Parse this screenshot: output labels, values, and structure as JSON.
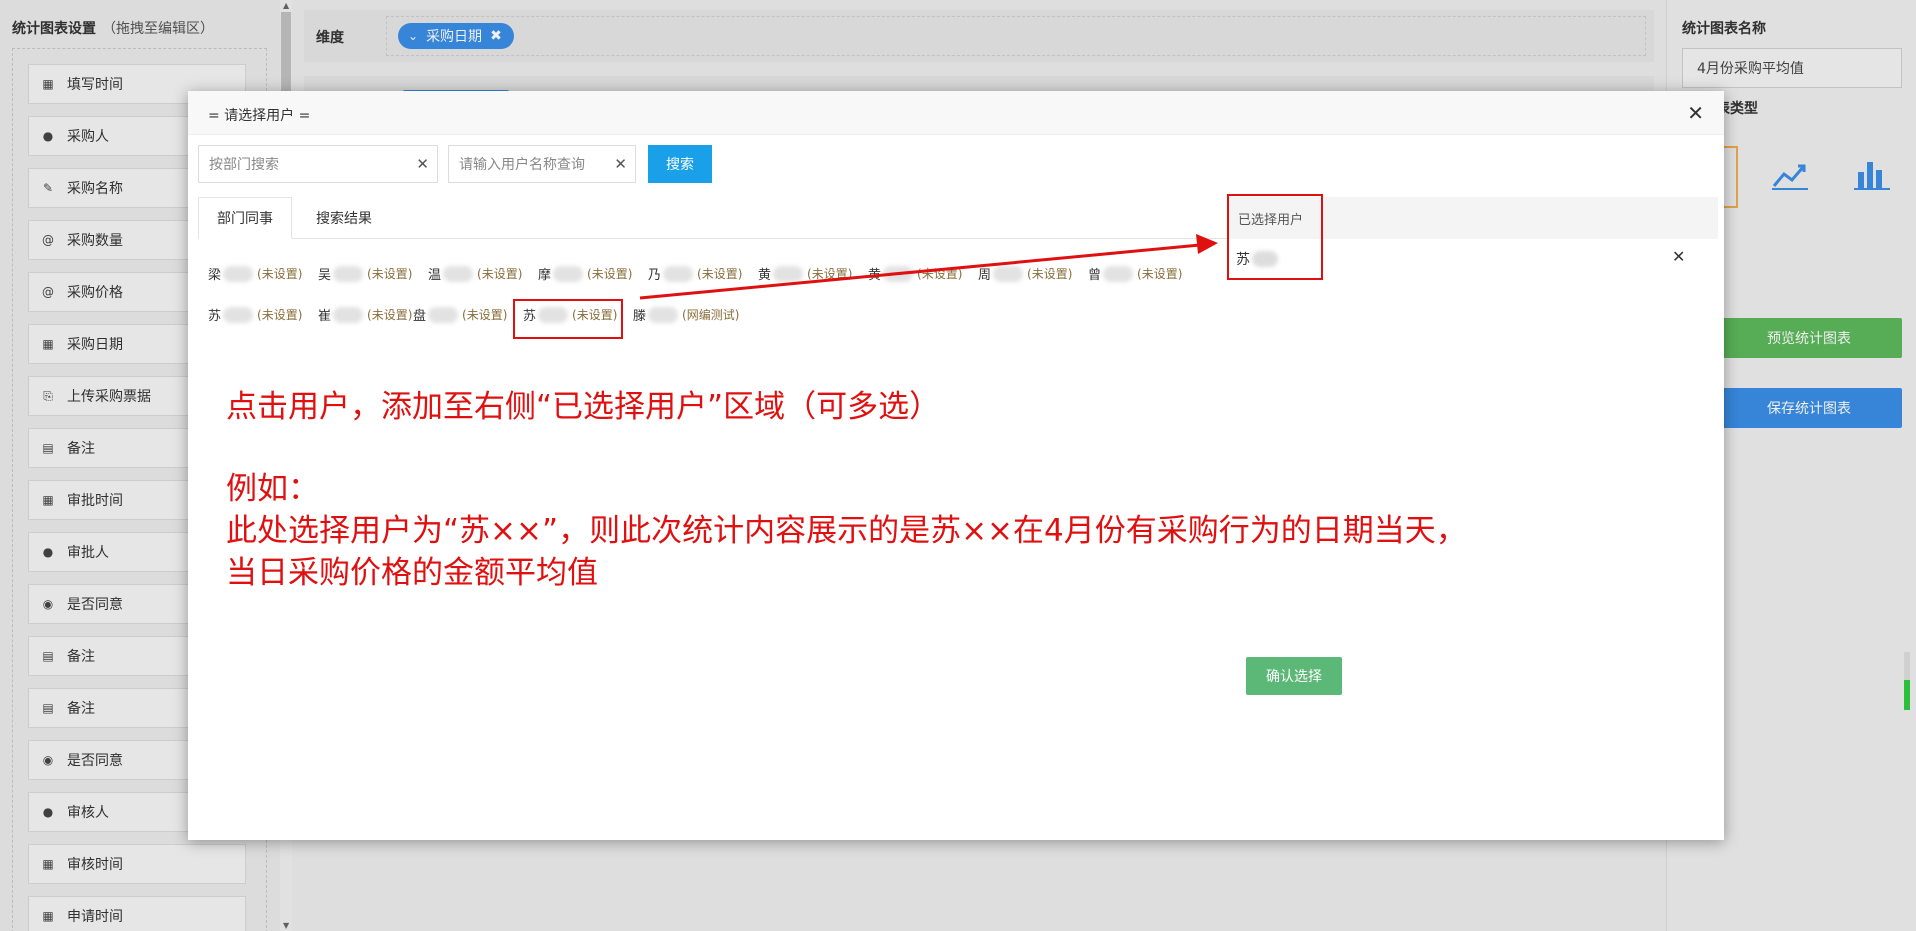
{
  "left_panel": {
    "title": "统计图表设置",
    "hint": "（拖拽至编辑区）",
    "fields": [
      {
        "icon": "calendar-icon",
        "glyph": "▦",
        "label": "填写时间"
      },
      {
        "icon": "user-icon",
        "glyph": "●",
        "label": "采购人"
      },
      {
        "icon": "edit-icon",
        "glyph": "✎",
        "label": "采购名称"
      },
      {
        "icon": "at-icon",
        "glyph": "@",
        "label": "采购数量"
      },
      {
        "icon": "at-icon",
        "glyph": "@",
        "label": "采购价格"
      },
      {
        "icon": "calendar-icon",
        "glyph": "▦",
        "label": "采购日期"
      },
      {
        "icon": "paperclip-icon",
        "glyph": "⎘",
        "label": "上传采购票据"
      },
      {
        "icon": "document-icon",
        "glyph": "▤",
        "label": "备注"
      },
      {
        "icon": "calendar-icon",
        "glyph": "▦",
        "label": "审批时间"
      },
      {
        "icon": "user-icon",
        "glyph": "●",
        "label": "审批人"
      },
      {
        "icon": "radio-icon",
        "glyph": "◉",
        "label": "是否同意"
      },
      {
        "icon": "document-icon",
        "glyph": "▤",
        "label": "备注"
      },
      {
        "icon": "document-icon",
        "glyph": "▤",
        "label": "备注"
      },
      {
        "icon": "radio-icon",
        "glyph": "◉",
        "label": "是否同意"
      },
      {
        "icon": "user-icon",
        "glyph": "●",
        "label": "审核人"
      },
      {
        "icon": "calendar-icon",
        "glyph": "▦",
        "label": "审核时间"
      },
      {
        "icon": "calendar-icon",
        "glyph": "▦",
        "label": "申请时间"
      }
    ]
  },
  "center_panel": {
    "dimension_label": "维度",
    "dimension_tag": "采购日期"
  },
  "right_panel": {
    "chart_name_label": "统计图表名称",
    "chart_name_value": "4月份采购平均值",
    "chart_type_label": "表类型",
    "preview_button": "预览统计图表",
    "save_button": "保存统计图表",
    "accent_color": "#3a8ee6",
    "green_color": "#5cb85c"
  },
  "modal": {
    "title": "= 请选择用户 =",
    "dept_search_placeholder": "按部门搜索",
    "name_search_placeholder": "请输入用户名称查询",
    "search_button": "搜索",
    "tabs": [
      "部门同事",
      "搜索结果"
    ],
    "selected_header": "已选择用户",
    "selected_users": [
      {
        "name": "苏"
      }
    ],
    "users": [
      {
        "name": "梁",
        "status": "(未设置)"
      },
      {
        "name": "吴",
        "status": "(未设置)"
      },
      {
        "name": "温",
        "status": "(未设置)"
      },
      {
        "name": "摩",
        "status": "(未设置)"
      },
      {
        "name": "乃",
        "status": "(未设置)"
      },
      {
        "name": "黄",
        "status": "(未设置)"
      },
      {
        "name": "黄",
        "status": "(未设置)"
      },
      {
        "name": "周",
        "status": "(未设置)"
      },
      {
        "name": "曾",
        "status": "(未设置)"
      },
      {
        "name": "苏",
        "status": "(未设置)"
      },
      {
        "name": "崔",
        "status": "(未设置)"
      },
      {
        "name": "盘",
        "status": "(未设置)"
      },
      {
        "name": "苏",
        "status": "(未设置)"
      },
      {
        "name": "滕",
        "status": "(网编测试)"
      }
    ],
    "confirm_button": "确认选择"
  },
  "annotation": {
    "line1": "点击用户，添加至右侧“已选择用户”区域（可多选）",
    "line2": "例如：",
    "line3": "此处选择用户为“苏××”，则此次统计内容展示的是苏××在4月份有采购行为的日期当天，",
    "line4": "当日采购价格的金额平均值",
    "color": "#e01010"
  }
}
